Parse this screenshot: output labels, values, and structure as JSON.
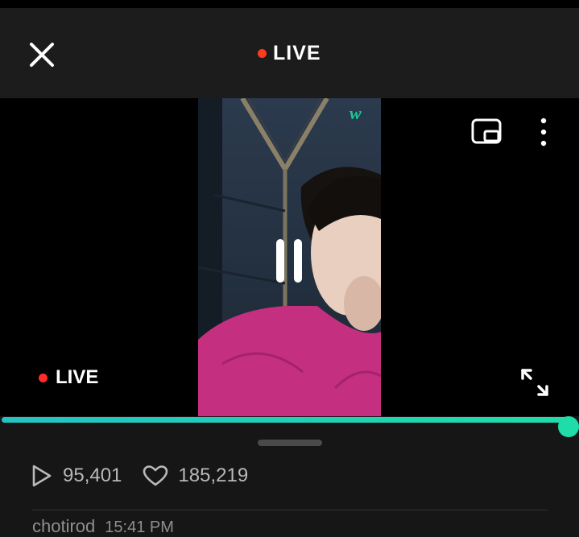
{
  "header": {
    "live_label": "LIVE",
    "live_dot_color": "#ff3a1f",
    "close_icon": "close-icon"
  },
  "player": {
    "live_label": "LIVE",
    "progress_fraction": 1.0,
    "accent_color": "#20dca8",
    "watermark_icon": "w-logo-icon"
  },
  "stats": {
    "plays": "95,401",
    "likes": "185,219"
  },
  "comment": {
    "user": "chotirod",
    "time": "15:41 PM"
  }
}
